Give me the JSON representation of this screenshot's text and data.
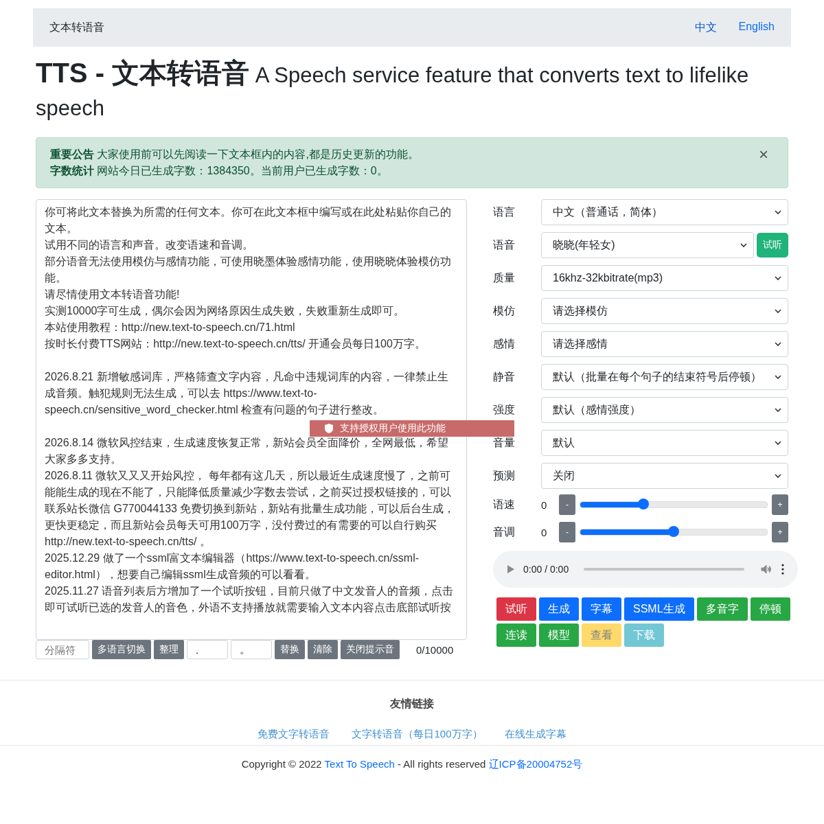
{
  "navbar": {
    "brand": "文本转语音",
    "links": [
      {
        "label": "中文",
        "selected": true
      },
      {
        "label": "English",
        "selected": false
      }
    ]
  },
  "heading": {
    "title": "TTS - 文本转语音",
    "subtitle": "A Speech service feature that converts text to lifelike speech"
  },
  "alert": {
    "lines": [
      "**重要公告** 大家使用前可以先阅读一下文本框内的内容,都是历史更新的功能。",
      "**字数统计** 网站今日已生成字数：1384350。当前用户已生成字数：0。"
    ],
    "close": "×"
  },
  "textarea": {
    "blocks": [
      [
        "你可将此文本替换为所需的任何文本。你可在此文本框中编写或在此处粘贴你自己的文本。",
        "试用不同的语言和声音。改变语速和音调。",
        "部分语音无法使用模仿与感情功能，可使用晓墨体验感情功能，使用晓晓体验模仿功能。",
        "请尽情使用文本转语音功能!",
        "实测10000字可生成，偶尔会因为网络原因生成失败，失败重新生成即可。",
        "本站使用教程：http://new.text-to-speech.cn/71.html",
        "按时长付费TTS网站：http://new.text-to-speech.cn/tts/  开通会员每日100万字。"
      ],
      [
        "2026.8.21 新增敏感词库，严格筛查文字内容，凡命中违规词库的内容，一律禁止生成音频。触犯规则无法生成，可以去 https://www.text-to-speech.cn/sensitive_word_checker.html 检查有问题的句子进行整改。"
      ],
      [
        "2026.8.14 微软风控结束，生成速度恢复正常，新站会员全面降价，全网最低，希望大家多多支持。",
        "2026.8.11 微软又又又开始风控， 每年都有这几天，所以最近生成速度慢了，之前可能能生成的现在不能了，只能降低质量减少字数去尝试，之前买过授权链接的，可以联系站长微信 G770044133 免费切换到新站，新站有批量生成功能，可以后台生成，更快更稳定，而且新站会员每天可用100万字，没付费过的有需要的可以自行购买 http://new.text-to-speech.cn/tts/ 。",
        "2025.12.29 做了一个ssml富文本编辑器（https://www.text-to-speech.cn/ssml-editor.html），想要自己编辑ssml生成音频的可以看看。",
        "2025.11.27 语音列表后方增加了一个试听按钮，目前只做了中文发音人的音频，点击即可试听已选的发音人的音色，外语不支持播放就需要输入文本内容点击底部试听按"
      ]
    ]
  },
  "toolbar": [
    {
      "kind": "input",
      "placeholder": "分隔符"
    },
    {
      "kind": "button",
      "label": "多语言切换"
    },
    {
      "kind": "button",
      "label": "整理"
    },
    {
      "kind": "input",
      "value": "."
    },
    {
      "kind": "input",
      "value": "。"
    },
    {
      "kind": "button",
      "label": "替换"
    },
    {
      "kind": "button",
      "label": "清除"
    },
    {
      "kind": "button",
      "label": "关闭提示音"
    },
    {
      "kind": "counter",
      "text": "0/10000"
    }
  ],
  "toast": {
    "text": "支持授权用户使用此功能"
  },
  "settings": [
    {
      "kind": "select",
      "label": "语言",
      "value": "中文（普通话，简体）"
    },
    {
      "kind": "select",
      "label": "语音",
      "value": "晓晓(年轻女)",
      "button": "试听"
    },
    {
      "kind": "select",
      "label": "质量",
      "value": "16khz-32kbitrate(mp3)"
    },
    {
      "kind": "select",
      "label": "模仿",
      "value": "请选择模仿"
    },
    {
      "kind": "select",
      "label": "感情",
      "value": "请选择感情"
    },
    {
      "kind": "select",
      "label": "静音",
      "value": "默认（批量在每个句子的结束符号后停顿）"
    },
    {
      "kind": "select",
      "label": "强度",
      "value": "默认（感情强度）"
    },
    {
      "kind": "select",
      "label": "音量",
      "value": "默认"
    },
    {
      "kind": "select",
      "label": "预测",
      "value": "关闭"
    },
    {
      "kind": "slider",
      "label": "语速",
      "reading": "0",
      "minus": "-",
      "plus": "+",
      "level": 0.34
    },
    {
      "kind": "slider",
      "label": "音调",
      "reading": "0",
      "minus": "-",
      "plus": "+",
      "level": 0.5
    }
  ],
  "player": {
    "time": "0:00 / 0:00",
    "level": 0
  },
  "actions": [
    {
      "label": "试听",
      "kind": "danger",
      "disabled": false
    },
    {
      "label": "生成",
      "kind": "primary",
      "disabled": false
    },
    {
      "label": "字幕",
      "kind": "primary",
      "disabled": false
    },
    {
      "label": "SSML生成",
      "kind": "primary",
      "disabled": false
    },
    {
      "label": "多音字",
      "kind": "success",
      "disabled": false
    },
    {
      "label": "停顿",
      "kind": "success",
      "disabled": false
    },
    {
      "label": "连读",
      "kind": "success",
      "disabled": false
    },
    {
      "label": "模型",
      "kind": "success",
      "disabled": false
    },
    {
      "label": "查看",
      "kind": "warning",
      "disabled": true
    },
    {
      "label": "下载",
      "kind": "info",
      "disabled": true
    }
  ],
  "footer": {
    "title": "友情链接",
    "links": [
      "免费文字转语音",
      "文字转语音（每日100万字）",
      "在线生成字幕"
    ],
    "copyright": [
      {
        "kind": "text",
        "text": "Copyright © 2022 "
      },
      {
        "kind": "link",
        "text": "Text To Speech"
      },
      {
        "kind": "text",
        "text": " - All rights reserved "
      },
      {
        "kind": "link",
        "text": "辽ICP备20004752号"
      }
    ]
  }
}
